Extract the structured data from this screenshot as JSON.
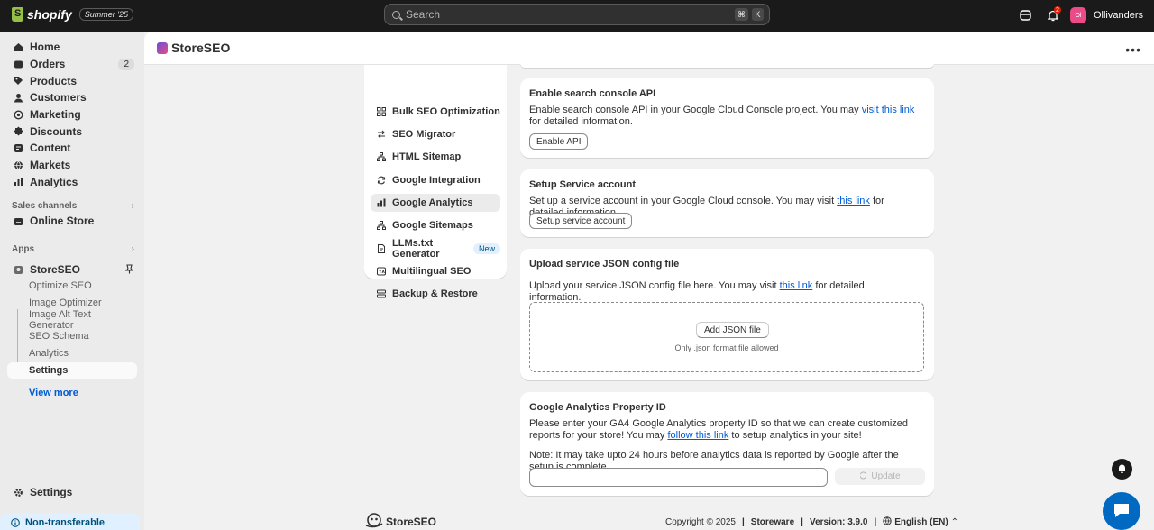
{
  "topbar": {
    "brand": "shopify",
    "edition": "Summer '25",
    "search_placeholder": "Search",
    "shortcut_keys": [
      "⌘",
      "K"
    ],
    "notification_count": "2",
    "store_initials": "Ol",
    "store_name": "Ollivanders"
  },
  "sidebar": {
    "items": [
      {
        "label": "Home",
        "icon": "home-icon"
      },
      {
        "label": "Orders",
        "icon": "orders-icon",
        "count": "2"
      },
      {
        "label": "Products",
        "icon": "tag-icon"
      },
      {
        "label": "Customers",
        "icon": "person-icon"
      },
      {
        "label": "Marketing",
        "icon": "target-icon"
      },
      {
        "label": "Discounts",
        "icon": "discount-icon"
      },
      {
        "label": "Content",
        "icon": "content-icon"
      },
      {
        "label": "Markets",
        "icon": "globe-icon"
      },
      {
        "label": "Analytics",
        "icon": "chart-icon"
      }
    ],
    "sales_channels_label": "Sales channels",
    "online_store": "Online Store",
    "apps_label": "Apps",
    "app_name": "StoreSEO",
    "app_sub_items": [
      "Optimize SEO",
      "Image Optimizer",
      "Image Alt Text Generator",
      "SEO Schema",
      "Analytics",
      "Settings"
    ],
    "view_more": "View more",
    "settings": "Settings",
    "non_transferable": "Non-transferable"
  },
  "app_header": {
    "title": "StoreSEO"
  },
  "settings_menu": {
    "items": [
      {
        "label": "Bulk SEO Optimization",
        "icon": "grid-icon"
      },
      {
        "label": "SEO Migrator",
        "icon": "arrows-icon"
      },
      {
        "label": "HTML Sitemap",
        "icon": "sitemap-icon"
      },
      {
        "label": "Google Integration",
        "icon": "refresh-icon"
      },
      {
        "label": "Google Analytics",
        "icon": "bar-chart-icon",
        "active": true
      },
      {
        "label": "Google Sitemaps",
        "icon": "sitemap-icon"
      },
      {
        "label": "LLMs.txt Generator",
        "icon": "file-icon",
        "badge": "New"
      },
      {
        "label": "Multilingual SEO",
        "icon": "language-icon"
      },
      {
        "label": "Backup & Restore",
        "icon": "backup-icon"
      }
    ]
  },
  "cards": {
    "search_console": {
      "title": "Enable search console API",
      "text_before": "Enable search console API in your Google Cloud Console project. You may ",
      "link": "visit this link",
      "text_after": " for detailed information.",
      "button": "Enable API"
    },
    "service_account": {
      "title": "Setup Service account",
      "text_before": "Set up a service account in your Google Cloud console. You may visit ",
      "link": "this link",
      "text_after": " for detailed information.",
      "button": "Setup service account"
    },
    "json_upload": {
      "title": "Upload service JSON config file",
      "text_before": "Upload your service JSON config file here. You may visit ",
      "link": "this link",
      "text_after": " for detailed information.",
      "button": "Add JSON file",
      "hint": "Only .json format file allowed"
    },
    "ga_property": {
      "title": "Google Analytics Property ID",
      "text_before": "Please enter your GA4 Google Analytics property ID so that we can create customized reports for your store! You may ",
      "link": "follow this link",
      "text_after": " to setup analytics in your site!",
      "note": "Note: It may take upto 24 hours before analytics data is reported by Google after the setup is complete.",
      "input_value": "",
      "button": "Update"
    }
  },
  "footer": {
    "logo_text": "StoreSEO",
    "copyright": "Copyright © 2025",
    "company": "Storeware",
    "version": "Version: 3.9.0",
    "language": "English (EN)"
  }
}
